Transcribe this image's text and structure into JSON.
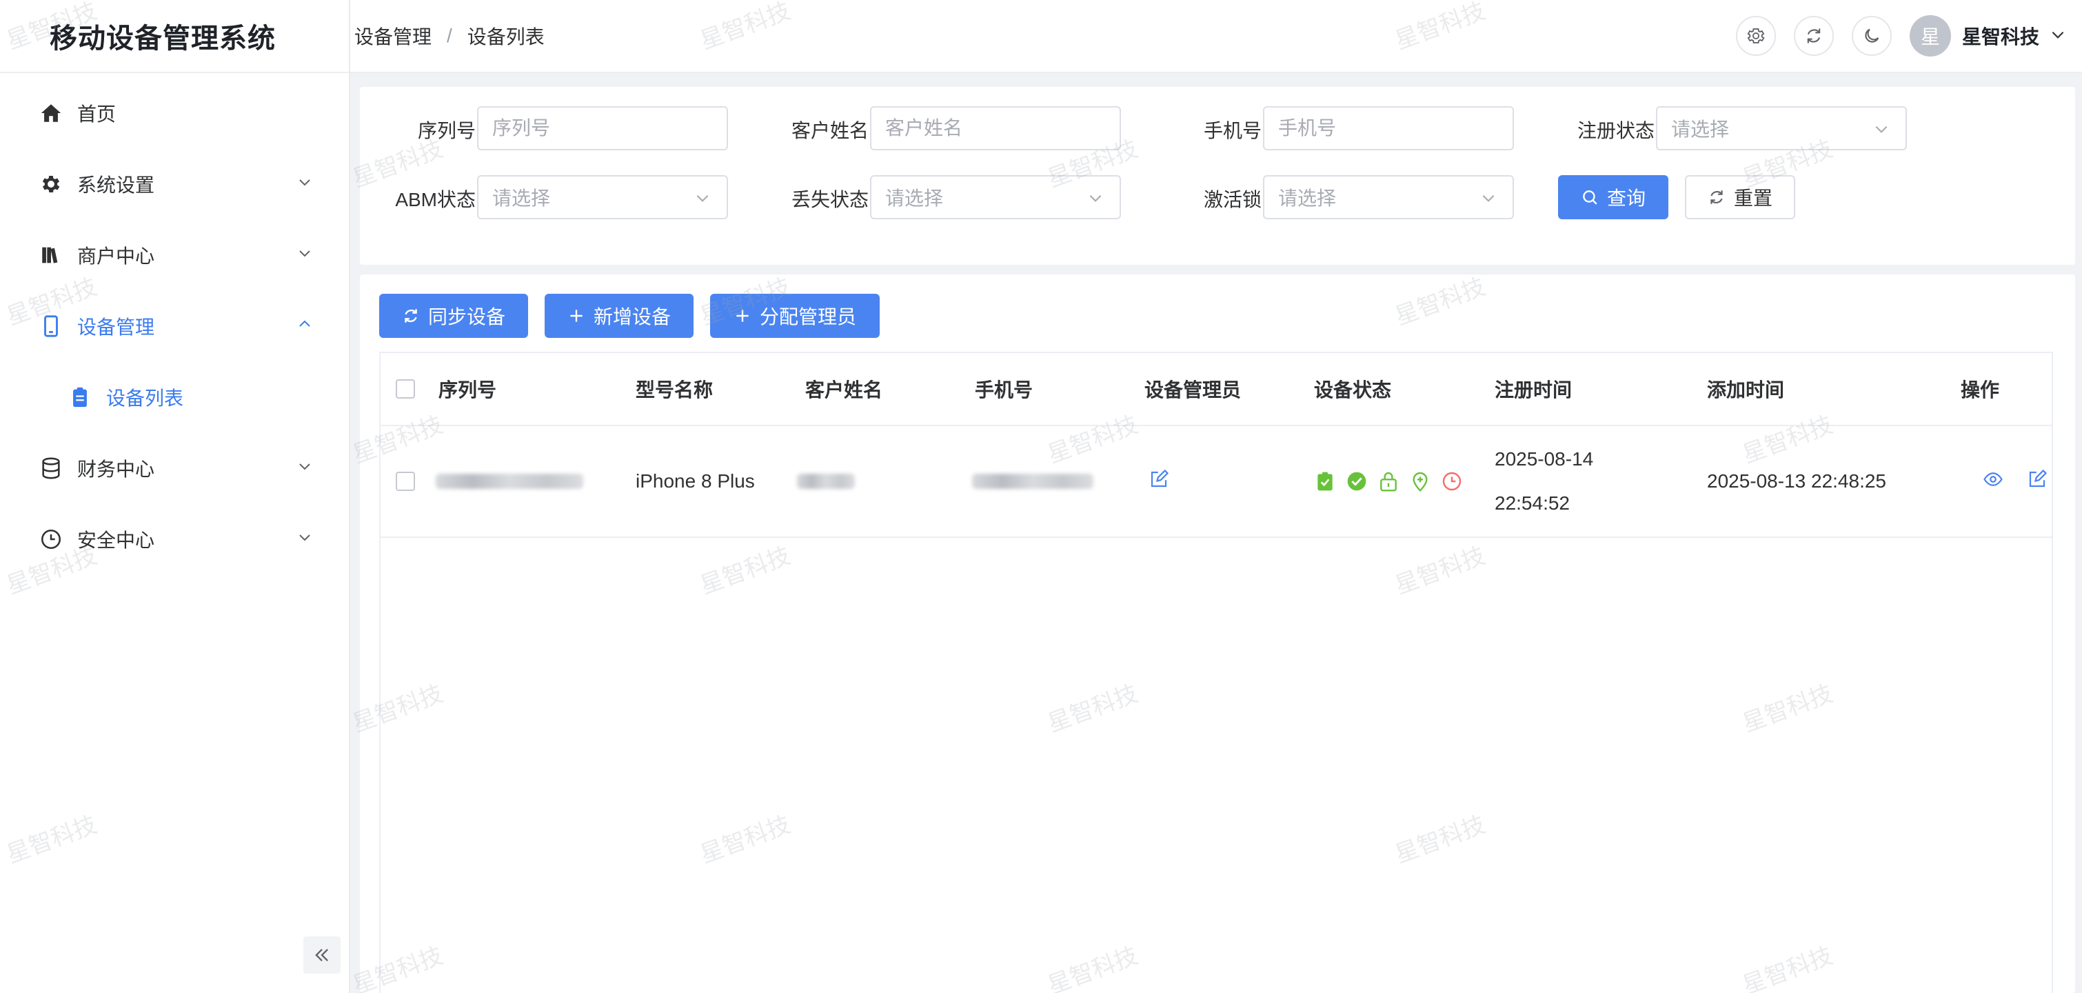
{
  "app": {
    "title": "移动设备管理系统"
  },
  "sidebar": {
    "items": [
      {
        "label": "首页",
        "icon": "home-icon"
      },
      {
        "label": "系统设置",
        "icon": "gear-icon"
      },
      {
        "label": "商户中心",
        "icon": "books-icon"
      },
      {
        "label": "设备管理",
        "icon": "phone-icon",
        "active": true,
        "expanded": true
      },
      {
        "label": "设备列表",
        "icon": "clipboard-icon",
        "active": true
      },
      {
        "label": "财务中心",
        "icon": "database-icon"
      },
      {
        "label": "安全中心",
        "icon": "clock-icon"
      }
    ]
  },
  "header": {
    "breadcrumb": [
      "设备管理",
      "设备列表"
    ],
    "user": {
      "avatar_text": "星",
      "name": "星智科技"
    }
  },
  "search": {
    "serial": {
      "label": "序列号",
      "placeholder": "序列号"
    },
    "customer": {
      "label": "客户姓名",
      "placeholder": "客户姓名"
    },
    "phone": {
      "label": "手机号",
      "placeholder": "手机号"
    },
    "register_status": {
      "label": "注册状态",
      "placeholder": "请选择"
    },
    "abm_status": {
      "label": "ABM状态",
      "placeholder": "请选择"
    },
    "lost_status": {
      "label": "丢失状态",
      "placeholder": "请选择"
    },
    "activation_lock": {
      "label": "激活锁",
      "placeholder": "请选择"
    },
    "query_label": "查询",
    "reset_label": "重置"
  },
  "toolbar": {
    "sync_label": "同步设备",
    "add_label": "新增设备",
    "assign_label": "分配管理员"
  },
  "table": {
    "columns": [
      "序列号",
      "型号名称",
      "客户姓名",
      "手机号",
      "设备管理员",
      "设备状态",
      "注册时间",
      "添加时间",
      "操作"
    ],
    "rows": [
      {
        "model": "iPhone 8 Plus",
        "register_date": "2025-08-14",
        "register_time": "22:54:52",
        "added": "2025-08-13 22:48:25"
      }
    ]
  },
  "watermark": "星智科技",
  "colors": {
    "primary": "#4a84f0",
    "success": "#67c23a",
    "danger": "#f56c6c"
  }
}
